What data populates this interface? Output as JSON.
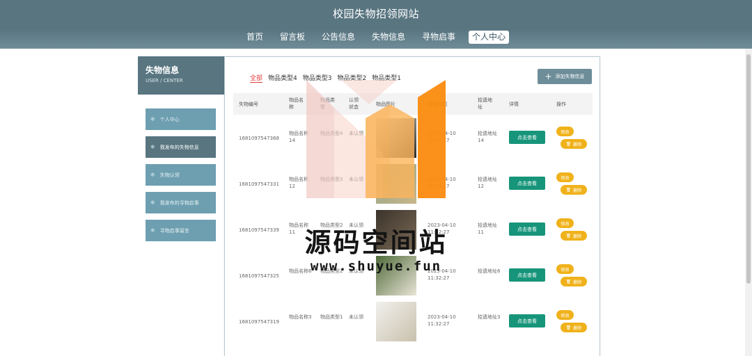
{
  "site": {
    "title": "校园失物招领网站"
  },
  "nav": [
    "首页",
    "留言板",
    "公告信息",
    "失物信息",
    "寻物启事",
    "个人中心"
  ],
  "nav_active": 5,
  "sidebar": {
    "title": "失物信息",
    "subtitle": "USER / CENTER",
    "items": [
      "个人中心",
      "我发布的失物信息",
      "失物认领",
      "我发布的寻物启事",
      "寻物启事留言"
    ],
    "active": 1
  },
  "filters": [
    "全部",
    "物品类型4",
    "物品类型3",
    "物品类型2",
    "物品类型1"
  ],
  "add_button": "添加失物信息",
  "table": {
    "headers": [
      "失物编号",
      "物品名称",
      "物品类型",
      "认领状态",
      "物品图片",
      "拾遗时间",
      "拾遗地址",
      "详情",
      "操作"
    ],
    "rows": [
      {
        "id": "1681097547368",
        "name": "物品名称14",
        "type": "物品类型4",
        "status": "未认领",
        "time": "2023-04-10 11:32:27",
        "addr": "拾遗地址14",
        "detail": "点击查看",
        "edit": "修改",
        "delete": "删除",
        "img_colors": [
          "#e6e3dd",
          "#2b2b2b"
        ]
      },
      {
        "id": "1681097547331",
        "name": "物品名称12",
        "type": "物品类型3",
        "status": "未认领",
        "time": "2023-04-10 11:32:27",
        "addr": "拾遗地址12",
        "detail": "点击查看",
        "edit": "修改",
        "delete": "删除",
        "img_colors": [
          "#8ca58b",
          "#c8b68a"
        ]
      },
      {
        "id": "1681097547339",
        "name": "物品名称11",
        "type": "物品类型2",
        "status": "未认领",
        "time": "2023-04-10 11:32:27",
        "addr": "拾遗地址11",
        "detail": "点击查看",
        "edit": "修改",
        "delete": "删除",
        "img_colors": [
          "#3b332b",
          "#7a6a55"
        ]
      },
      {
        "id": "1681097547325",
        "name": "物品名称6",
        "type": "物品类型2",
        "status": "未认领",
        "time": "2023-04-10 11:32:27",
        "addr": "拾遗地址6",
        "detail": "点击查看",
        "edit": "修改",
        "delete": "删除",
        "img_colors": [
          "#4f6b3a",
          "#e9e4d6"
        ]
      },
      {
        "id": "1681097547319",
        "name": "物品名称3",
        "type": "物品类型1",
        "status": "未认领",
        "time": "2023-04-10 11:32:27",
        "addr": "拾遗地址3",
        "detail": "点击查看",
        "edit": "修改",
        "delete": "删除",
        "img_colors": [
          "#f1f0ec",
          "#c9c1ad"
        ]
      }
    ]
  },
  "watermark": {
    "text": "源码空间站",
    "url": "www.shuyue.fun"
  },
  "colors": {
    "header": "#587580",
    "menu": "#6d9fb0",
    "detail": "#17957a",
    "action": "#f0b21b",
    "filter_active": "#e23b3b"
  }
}
